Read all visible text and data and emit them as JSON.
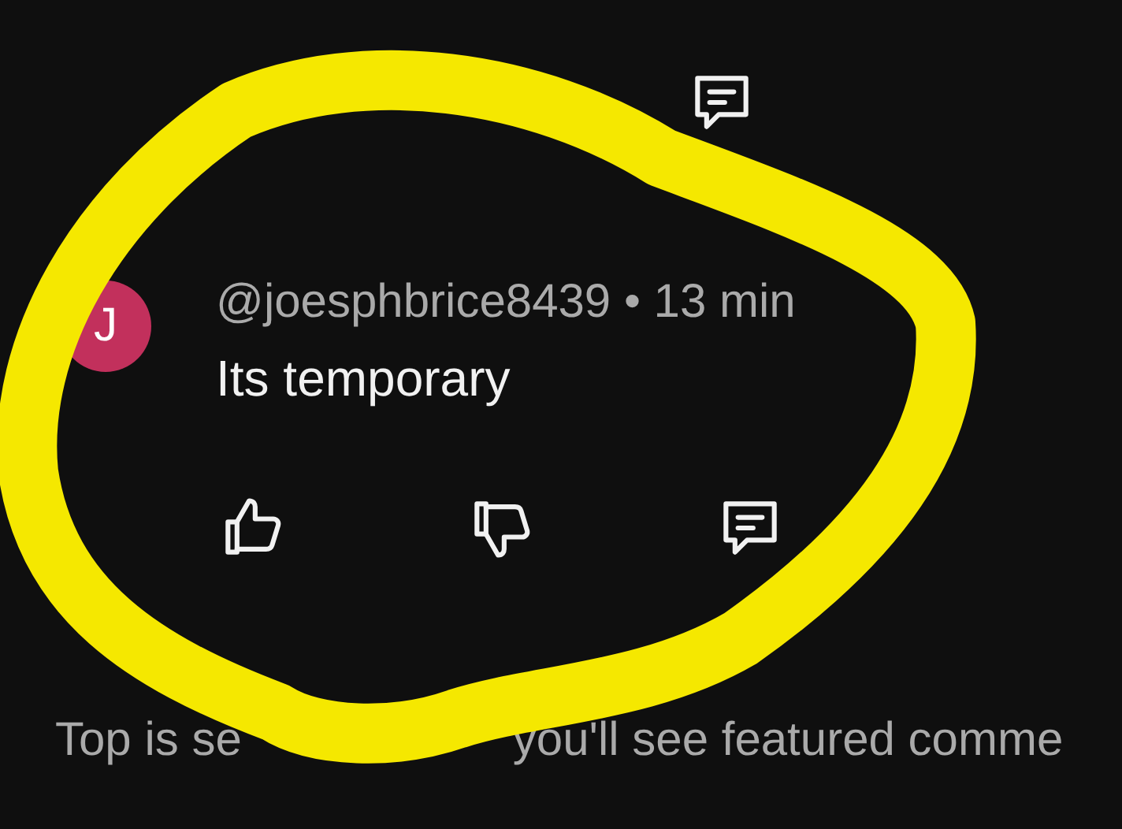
{
  "comment": {
    "avatar_letter": "J",
    "author_line": "@joesphbrice8439 • 13 min",
    "text": "Its temporary"
  },
  "footer_parts": [
    "Top is se",
    "you'll see featured comme"
  ]
}
